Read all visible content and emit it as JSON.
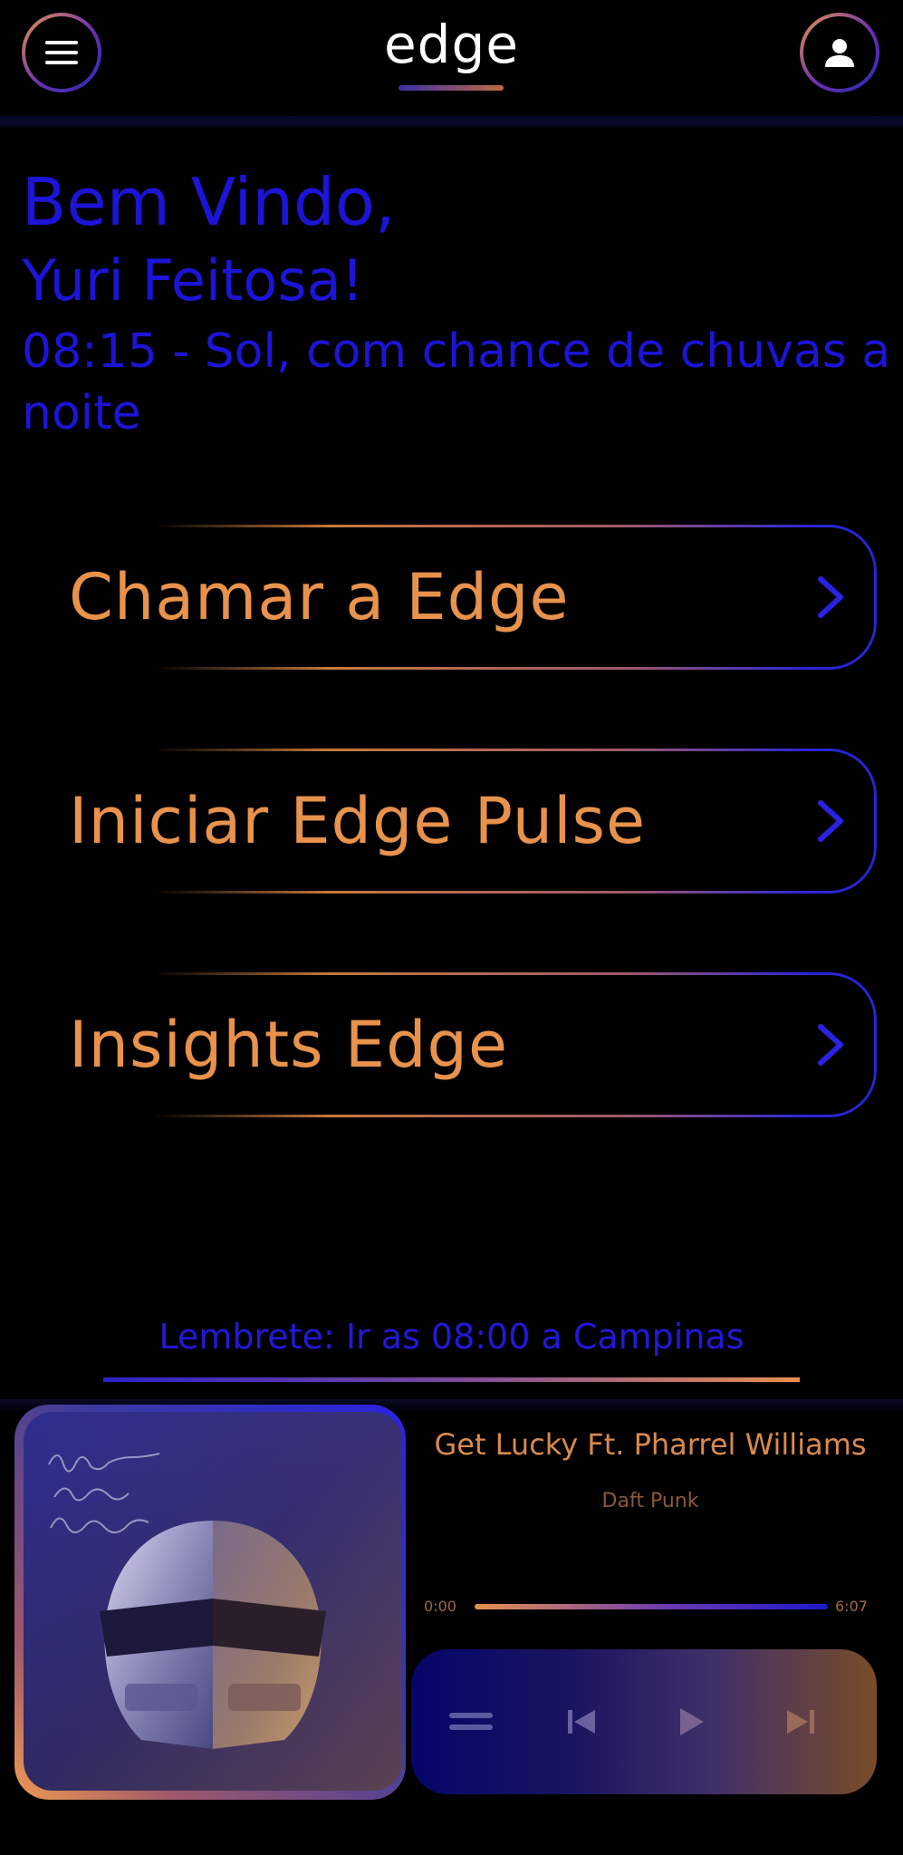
{
  "header": {
    "brand": "edge",
    "menu_icon": "hamburger-menu-icon",
    "user_icon": "user-icon"
  },
  "greeting": {
    "line1": "Bem Vindo,",
    "line2": "Yuri Feitosa!",
    "weather": "08:15 - Sol, com chance de chuvas a noite"
  },
  "actions": [
    {
      "label": "Chamar a Edge",
      "icon": "chevron-right-icon"
    },
    {
      "label": "Iniciar Edge Pulse",
      "icon": "chevron-right-icon"
    },
    {
      "label": "Insights Edge",
      "icon": "chevron-right-icon"
    }
  ],
  "reminder": {
    "text": "Lembrete: Ir as 08:00 a Campinas"
  },
  "player": {
    "album_art": "Random Access Memories",
    "title": "Get Lucky Ft. Pharrel Williams",
    "artist": "Daft Punk",
    "time_current": "0:00",
    "time_total": "6:07",
    "progress": 0.0,
    "controls": [
      "queue-icon",
      "previous-icon",
      "play-icon",
      "next-icon"
    ]
  },
  "colors": {
    "background": "#000000",
    "accent_blue": "#1c14d6",
    "accent_orange": "#e8924c"
  }
}
